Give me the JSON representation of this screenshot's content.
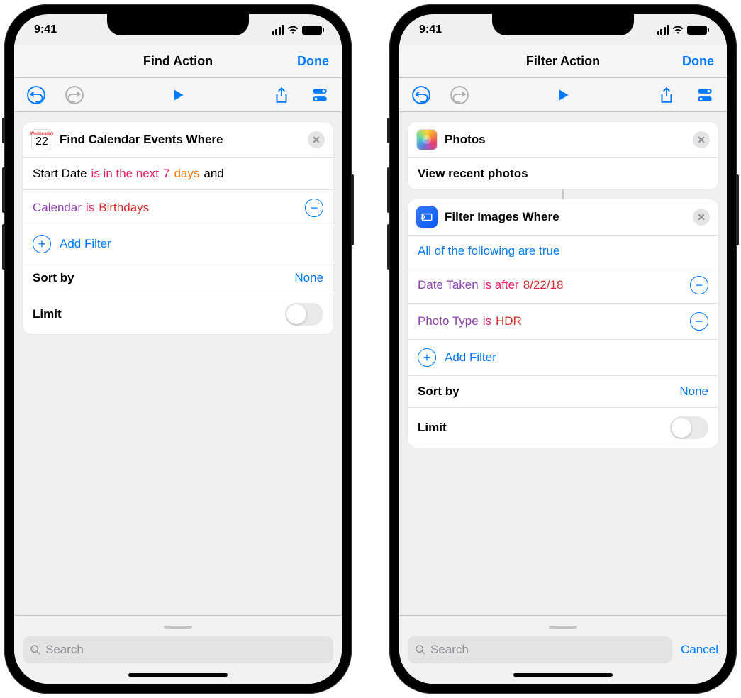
{
  "status": {
    "time": "9:41"
  },
  "left": {
    "nav": {
      "title": "Find Action",
      "done": "Done"
    },
    "card": {
      "title": "Find Calendar Events Where",
      "r1": {
        "field": "Start Date",
        "op": "is in the next",
        "num": "7",
        "unit": "days",
        "and": "and"
      },
      "r2": {
        "field": "Calendar",
        "op": "is",
        "val": "Birthdays"
      },
      "addFilter": "Add Filter",
      "sortBy": {
        "label": "Sort by",
        "value": "None"
      },
      "limit": "Limit",
      "cal": {
        "day": "Wednesday",
        "num": "22"
      }
    },
    "search": {
      "placeholder": "Search"
    }
  },
  "right": {
    "nav": {
      "title": "Filter Action",
      "done": "Done"
    },
    "photosCard": {
      "title": "Photos",
      "subtitle": "View recent photos"
    },
    "filterCard": {
      "title": "Filter Images Where",
      "allTrue": "All of the following are true",
      "r1": {
        "field": "Date Taken",
        "op": "is after",
        "val": "8/22/18"
      },
      "r2": {
        "field": "Photo Type",
        "op": "is",
        "val": "HDR"
      },
      "addFilter": "Add Filter",
      "sortBy": {
        "label": "Sort by",
        "value": "None"
      },
      "limit": "Limit"
    },
    "search": {
      "placeholder": "Search",
      "cancel": "Cancel"
    }
  }
}
